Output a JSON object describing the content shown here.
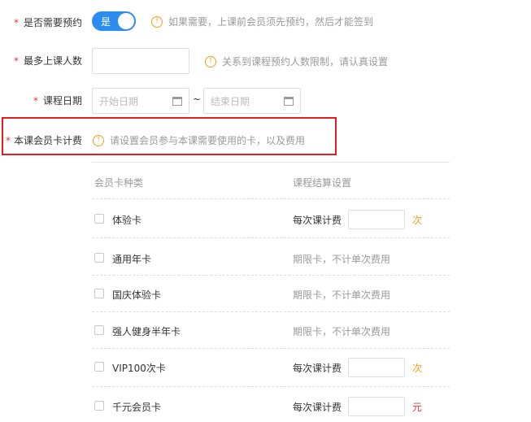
{
  "form": {
    "booking": {
      "required_mark": "*",
      "label": "是否需要预约",
      "toggle_text": "是",
      "hint": "如果需要，上课前会员须先预约，然后才能签到"
    },
    "max_people": {
      "required_mark": "*",
      "label": "最多上课人数",
      "value": "",
      "hint": "关系到课程预约人数限制，请认真设置"
    },
    "course_date": {
      "required_mark": "*",
      "label": "课程日期",
      "start_placeholder": "开始日期",
      "separator": "~",
      "end_placeholder": "结束日期"
    },
    "card_fee": {
      "required_mark": "*",
      "label": "本课会员卡计费",
      "hint": "请设置会员参与本课需要使用的卡，以及费用"
    }
  },
  "hint_icon_glyph": "!",
  "table": {
    "headers": [
      "会员卡种类",
      "课程结算设置"
    ],
    "rows": [
      {
        "name": "体验卡",
        "type": "count",
        "fee_label": "每次课计费",
        "value": "",
        "unit": "次",
        "unit_color": "#f0a020"
      },
      {
        "name": "通用年卡",
        "type": "period",
        "note": "期限卡，不计单次费用"
      },
      {
        "name": "国庆体验卡",
        "type": "period",
        "note": "期限卡，不计单次费用"
      },
      {
        "name": "强人健身半年卡",
        "type": "period",
        "note": "期限卡，不计单次费用"
      },
      {
        "name": "VIP100次卡",
        "type": "count",
        "fee_label": "每次课计费",
        "value": "",
        "unit": "次",
        "unit_color": "#f0a020"
      },
      {
        "name": "千元会员卡",
        "type": "money",
        "fee_label": "每次课计费",
        "value": "",
        "unit": "元",
        "unit_color": "#e4393c"
      }
    ]
  },
  "colors": {
    "accent": "#2d8cf0",
    "required": "#e4393c",
    "warning": "#f0a020",
    "highlight_box": "#e02020"
  },
  "icons": {
    "hint": "exclamation-circle-icon",
    "calendar": "calendar-icon",
    "checkbox": "checkbox-icon"
  }
}
